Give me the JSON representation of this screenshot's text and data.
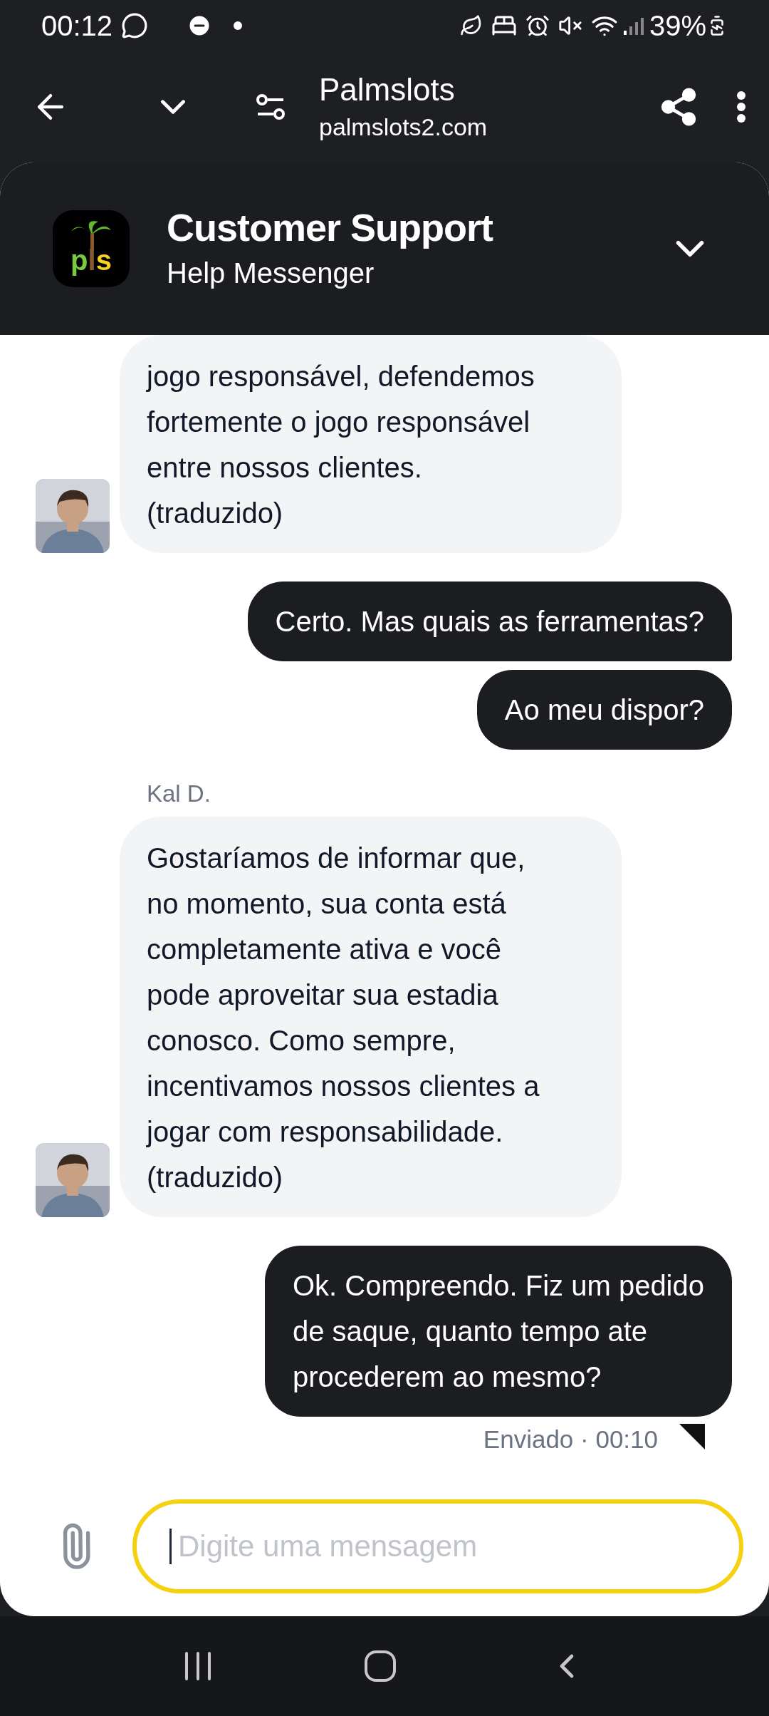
{
  "status_bar": {
    "time": "00:12",
    "battery": "39%"
  },
  "browser": {
    "title": "Palmslots",
    "url": "palmslots2.com"
  },
  "chat_header": {
    "logo_text": "pls",
    "title": "Customer Support",
    "subtitle": "Help Messenger"
  },
  "messages": [
    {
      "kind": "agent",
      "lines": [
        "jogo responsável, defendemos",
        "fortemente o jogo responsável",
        "entre nossos clientes.",
        "(traduzido)"
      ]
    },
    {
      "kind": "user",
      "lines": [
        "Certo. Mas quais as ferramentas?"
      ]
    },
    {
      "kind": "user",
      "lines": [
        "Ao meu dispor?"
      ]
    },
    {
      "kind": "agent",
      "sender": "Kal D.",
      "lines": [
        "Gostaríamos de informar que,",
        "no momento, sua conta está",
        "completamente ativa e você",
        "pode aproveitar sua estadia",
        "conosco. Como sempre,",
        "incentivamos nossos clientes a",
        "jogar com responsabilidade.",
        "(traduzido)"
      ]
    },
    {
      "kind": "user",
      "lines": [
        "Ok. Compreendo. Fiz um pedido",
        "de saque, quanto tempo ate",
        "procederem ao mesmo?"
      ],
      "status": "Enviado · 00:10"
    }
  ],
  "composer": {
    "placeholder": "Digite uma mensagem"
  }
}
